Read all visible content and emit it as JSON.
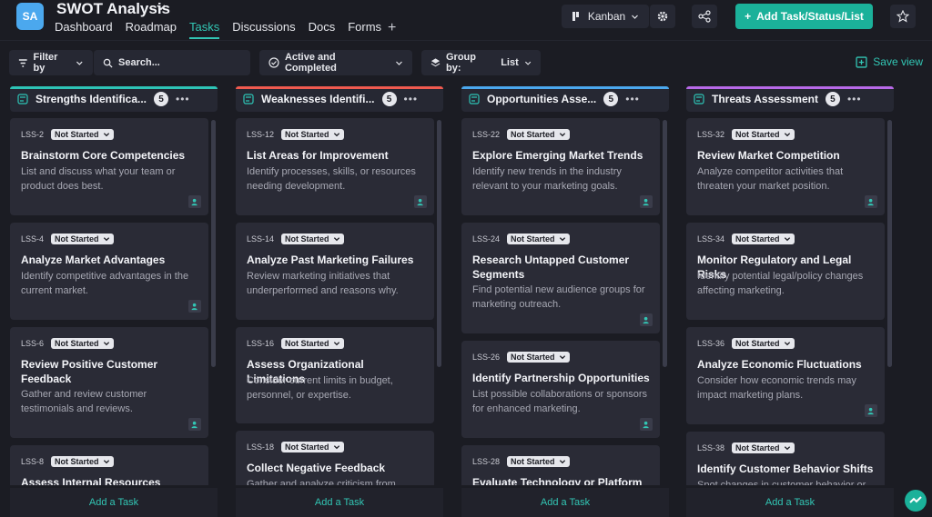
{
  "header": {
    "avatar_initials": "SA",
    "title": "SWOT Analysis",
    "tabs": [
      {
        "label": "Dashboard"
      },
      {
        "label": "Roadmap"
      },
      {
        "label": "Tasks"
      },
      {
        "label": "Discussions"
      },
      {
        "label": "Docs"
      },
      {
        "label": "Forms"
      }
    ],
    "active_tab": "Tasks",
    "view_label": "Kanban",
    "add_button_label": "Add Task/Status/List"
  },
  "toolbar": {
    "filter_label": "Filter by",
    "search_placeholder": "Search...",
    "status_filter_label": "Active and Completed",
    "group_by_label": "Group by:",
    "group_by_value": "List",
    "save_view_label": "Save view"
  },
  "colors": {
    "accent": "#32c6b4",
    "strengths": "#2ec4b6",
    "weaknesses": "#f05a4f",
    "opportunities": "#4ba8ee",
    "threats": "#b869e8"
  },
  "columns": [
    {
      "name": "Strengths Identifica...",
      "count": "5",
      "add_task": "Add a Task",
      "cards": [
        {
          "id": "LSS-2",
          "status": "Not Started",
          "title": "Brainstorm Core Competencies",
          "description": "List and discuss what your team or product does best."
        },
        {
          "id": "LSS-4",
          "status": "Not Started",
          "title": "Analyze Market Advantages",
          "description": "Identify competitive advantages in the current market."
        },
        {
          "id": "LSS-6",
          "status": "Not Started",
          "title": "Review Positive Customer Feedback",
          "description": "Gather and review customer testimonials and reviews."
        },
        {
          "id": "LSS-8",
          "status": "Not Started",
          "title": "Assess Internal Resources",
          "description": ""
        }
      ]
    },
    {
      "name": "Weaknesses Identifi...",
      "count": "5",
      "add_task": "Add a Task",
      "cards": [
        {
          "id": "LSS-12",
          "status": "Not Started",
          "title": "List Areas for Improvement",
          "description": "Identify processes, skills, or resources needing development."
        },
        {
          "id": "LSS-14",
          "status": "Not Started",
          "title": "Analyze Past Marketing Failures",
          "description": "Review marketing initiatives that underperformed and reasons why."
        },
        {
          "id": "LSS-16",
          "status": "Not Started",
          "title": "Assess Organizational Limitations",
          "description": "Consider current limits in budget, personnel, or expertise."
        },
        {
          "id": "LSS-18",
          "status": "Not Started",
          "title": "Collect Negative Feedback",
          "description": "Gather and analyze criticism from"
        }
      ]
    },
    {
      "name": "Opportunities Asse...",
      "count": "5",
      "add_task": "Add a Task",
      "cards": [
        {
          "id": "LSS-22",
          "status": "Not Started",
          "title": "Explore Emerging Market Trends",
          "description": "Identify new trends in the industry relevant to your marketing goals."
        },
        {
          "id": "LSS-24",
          "status": "Not Started",
          "title": "Research Untapped Customer Segments",
          "description": "Find potential new audience groups for marketing outreach."
        },
        {
          "id": "LSS-26",
          "status": "Not Started",
          "title": "Identify Partnership Opportunities",
          "description": "List possible collaborations or sponsors for enhanced marketing."
        },
        {
          "id": "LSS-28",
          "status": "Not Started",
          "title": "Evaluate Technology or Platform",
          "description": ""
        }
      ]
    },
    {
      "name": "Threats Assessment",
      "count": "5",
      "add_task": "Add a Task",
      "cards": [
        {
          "id": "LSS-32",
          "status": "Not Started",
          "title": "Review Market Competition",
          "description": "Analyze competitor activities that threaten your market position."
        },
        {
          "id": "LSS-34",
          "status": "Not Started",
          "title": "Monitor Regulatory and Legal Risks",
          "description": "Identify potential legal/policy changes affecting marketing."
        },
        {
          "id": "LSS-36",
          "status": "Not Started",
          "title": "Analyze Economic Fluctuations",
          "description": "Consider how economic trends may impact marketing plans."
        },
        {
          "id": "LSS-38",
          "status": "Not Started",
          "title": "Identify Customer Behavior Shifts",
          "description": "Spot changes in customer behavior or"
        }
      ]
    }
  ]
}
